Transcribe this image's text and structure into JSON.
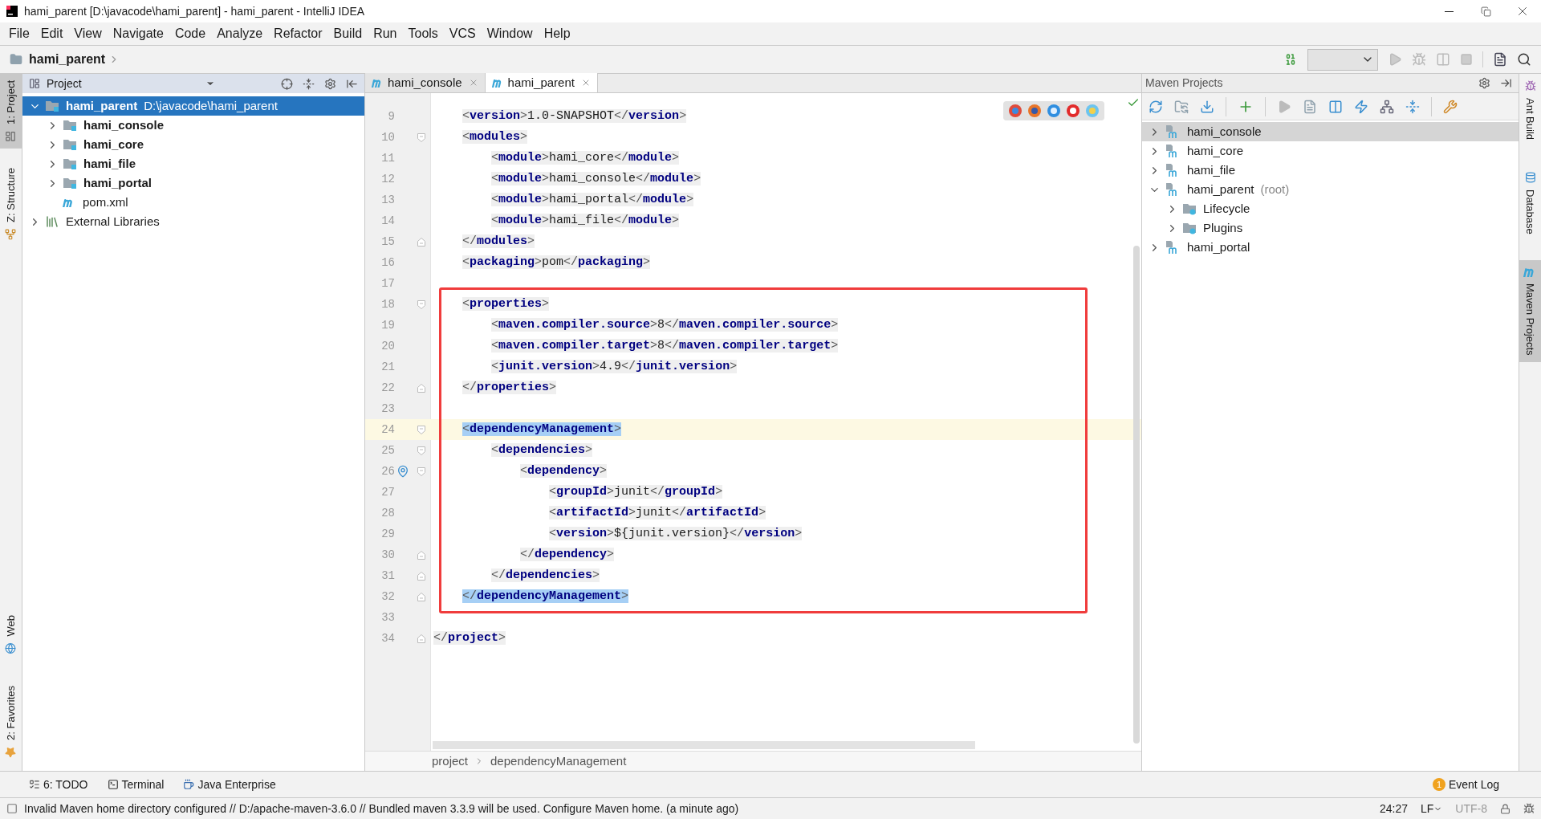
{
  "window": {
    "title": "hami_parent [D:\\javacode\\hami_parent] - hami_parent - IntelliJ IDEA"
  },
  "menu": [
    "File",
    "Edit",
    "View",
    "Navigate",
    "Code",
    "Analyze",
    "Refactor",
    "Build",
    "Run",
    "Tools",
    "VCS",
    "Window",
    "Help"
  ],
  "nav_bar": {
    "crumb": "hami_parent"
  },
  "left_tool_tabs_top": [
    {
      "label": "1: Project",
      "selected": true,
      "kind": "project"
    },
    {
      "label": "Z: Structure",
      "selected": false,
      "kind": "structure"
    }
  ],
  "left_tool_tabs_bottom": [
    {
      "label": "Web",
      "selected": false,
      "kind": "web"
    },
    {
      "label": "2: Favorites",
      "selected": false,
      "kind": "favorites"
    }
  ],
  "project_panel": {
    "title": "Project",
    "tree": [
      {
        "label": "hami_parent",
        "path": "D:\\javacode\\hami_parent",
        "kind": "module",
        "expanded": true,
        "selected": true,
        "children": [
          {
            "label": "hami_console",
            "kind": "module",
            "expanded": false,
            "selected": false
          },
          {
            "label": "hami_core",
            "kind": "module",
            "expanded": false,
            "selected": false
          },
          {
            "label": "hami_file",
            "kind": "module",
            "expanded": false,
            "selected": false
          },
          {
            "label": "hami_portal",
            "kind": "module",
            "expanded": false,
            "selected": false
          },
          {
            "label": "pom.xml",
            "kind": "pom",
            "selected": false
          }
        ]
      },
      {
        "label": "External Libraries",
        "kind": "library",
        "expanded": false,
        "selected": false
      }
    ]
  },
  "editor": {
    "tabs": [
      {
        "label": "hami_console",
        "selected": false
      },
      {
        "label": "hami_parent",
        "selected": true
      }
    ],
    "blocks": [
      {
        "kind": "plain",
        "lines": [
          {
            "number": "9",
            "text": "    <version>1.0-SNAPSHOT</version>"
          },
          {
            "number": "10",
            "text": "    <modules>",
            "fold_open": true
          },
          {
            "number": "11",
            "text": "        <module>hami_core</module>"
          },
          {
            "number": "12",
            "text": "        <module>hami_console</module>"
          },
          {
            "number": "13",
            "text": "        <module>hami_portal</module>"
          },
          {
            "number": "14",
            "text": "        <module>hami_file</module>"
          },
          {
            "number": "15",
            "text": "    </modules>",
            "fold_close": true
          },
          {
            "number": "16",
            "text": "    <packaging>pom</packaging>"
          },
          {
            "number": "17"
          }
        ]
      },
      {
        "kind": "annotated",
        "lines": [
          {
            "number": "18",
            "text": "    <properties>",
            "fold_open": true
          },
          {
            "number": "19",
            "text": "        <maven.compiler.source>8</maven.compiler.source>"
          },
          {
            "number": "20",
            "text": "        <maven.compiler.target>8</maven.compiler.target>"
          },
          {
            "number": "21",
            "text": "        <junit.version>4.9</junit.version>"
          },
          {
            "number": "22",
            "text": "    </properties>",
            "fold_close": true
          },
          {
            "number": "23"
          },
          {
            "number": "24",
            "text": "    <dependencyManagement>",
            "fold_open": true,
            "current": true,
            "highlighted": true
          },
          {
            "number": "25",
            "text": "        <dependencies>",
            "fold_open": true
          },
          {
            "number": "26",
            "text": "            <dependency>",
            "fold_open": true,
            "gutter_icon": true
          },
          {
            "number": "27",
            "text": "                <groupId>junit</groupId>"
          },
          {
            "number": "28",
            "text": "                <artifactId>junit</artifactId>"
          },
          {
            "number": "29",
            "text": "                <version>${junit.version}</version>"
          },
          {
            "number": "30",
            "text": "            </dependency>",
            "fold_close": true
          },
          {
            "number": "31",
            "text": "        </dependencies>",
            "fold_close": true
          },
          {
            "number": "32",
            "text": "    </dependencyManagement>",
            "fold_close": true,
            "highlighted": true
          }
        ]
      },
      {
        "kind": "plain",
        "lines": [
          {
            "number": "33"
          },
          {
            "number": "34",
            "text": "</project>",
            "fold_close": true
          }
        ]
      }
    ],
    "breadcrumbs": [
      "project",
      "dependencyManagement"
    ]
  },
  "maven_panel": {
    "title": "Maven Projects",
    "tree": [
      {
        "label": "hami_console",
        "kind": "module",
        "expanded": false,
        "selected": true
      },
      {
        "label": "hami_core",
        "kind": "module",
        "expanded": false,
        "selected": false
      },
      {
        "label": "hami_file",
        "kind": "module",
        "expanded": false,
        "selected": false
      },
      {
        "label": "hami_parent",
        "suffix": "(root)",
        "kind": "module",
        "expanded": true,
        "selected": false,
        "children": [
          {
            "label": "Lifecycle",
            "kind": "folder",
            "expanded": false,
            "selected": false
          },
          {
            "label": "Plugins",
            "kind": "folder",
            "expanded": false,
            "selected": false
          }
        ]
      },
      {
        "label": "hami_portal",
        "kind": "module",
        "expanded": false,
        "selected": false
      }
    ]
  },
  "right_tool_tabs": [
    {
      "label": "Ant Build",
      "selected": false,
      "kind": "ant"
    },
    {
      "label": "Database",
      "selected": false,
      "kind": "database"
    },
    {
      "label": "Maven Projects",
      "selected": true,
      "kind": "maven"
    }
  ],
  "bottom_tools": [
    {
      "label": "6: TODO",
      "kind": "todo"
    },
    {
      "label": "Terminal",
      "kind": "terminal"
    },
    {
      "label": "Java Enterprise",
      "kind": "javaee"
    }
  ],
  "event_log": {
    "label": "Event Log",
    "badge": "1"
  },
  "status_bar": {
    "message": "Invalid Maven home directory configured // D:/apache-maven-3.6.0 // Bundled maven 3.3.9 will be used.  Configure Maven home.  (a minute ago)",
    "items": [
      {
        "text": "24:27",
        "dropdown": false,
        "disabled": false
      },
      {
        "text": "LF",
        "dropdown": true,
        "disabled": false
      },
      {
        "text": "UTF-8",
        "dropdown": false,
        "disabled": true
      }
    ]
  }
}
